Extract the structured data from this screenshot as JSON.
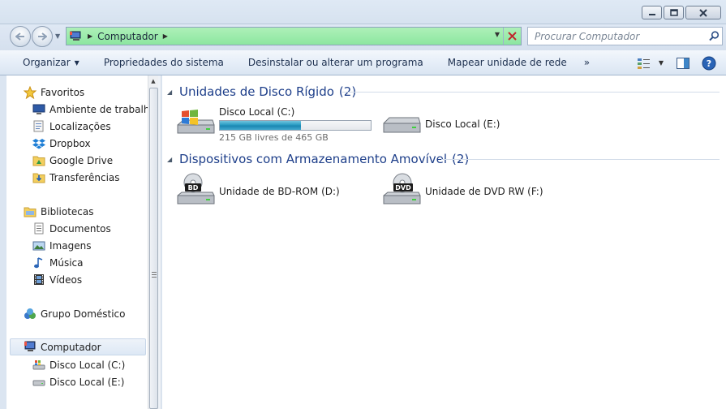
{
  "window": {
    "controls": [
      "minimize",
      "maximize",
      "close"
    ]
  },
  "address_bar": {
    "path": [
      "Computador"
    ],
    "search_placeholder": "Procurar Computador"
  },
  "toolbar": {
    "organize": "Organizar",
    "system_properties": "Propriedades do sistema",
    "uninstall": "Desinstalar ou alterar um programa",
    "map_drive": "Mapear unidade de rede",
    "more": "»"
  },
  "nav": {
    "favorites": {
      "label": "Favoritos",
      "items": [
        "Ambiente de trabalho",
        "Localizações",
        "Dropbox",
        "Google Drive",
        "Transferências"
      ]
    },
    "libraries": {
      "label": "Bibliotecas",
      "items": [
        "Documentos",
        "Imagens",
        "Música",
        "Vídeos"
      ]
    },
    "homegroup": "Grupo Doméstico",
    "computer": {
      "label": "Computador",
      "items": [
        "Disco Local (C:)",
        "Disco Local (E:)"
      ]
    }
  },
  "content": {
    "groups": [
      {
        "title": "Unidades de Disco Rígido",
        "count": "(2)",
        "drives": [
          {
            "name": "Disco Local (C:)",
            "free_text": "215 GB livres de 465 GB",
            "used_fraction": 0.54,
            "icon": "windows-hard-drive-icon"
          },
          {
            "name": "Disco Local (E:)",
            "icon": "hard-drive-icon"
          }
        ]
      },
      {
        "title": "Dispositivos com Armazenamento Amovível",
        "count": "(2)",
        "drives": [
          {
            "name": "Unidade de BD-ROM (D:)",
            "badge": "BD",
            "icon": "bd-rom-drive-icon"
          },
          {
            "name": "Unidade de DVD RW (F:)",
            "badge": "DVD",
            "icon": "dvd-drive-icon"
          }
        ]
      }
    ]
  },
  "colors": {
    "group_title": "#1e3f8a",
    "address_bg": "#8ce6a0",
    "usage_fill": "#2a9bc3"
  }
}
